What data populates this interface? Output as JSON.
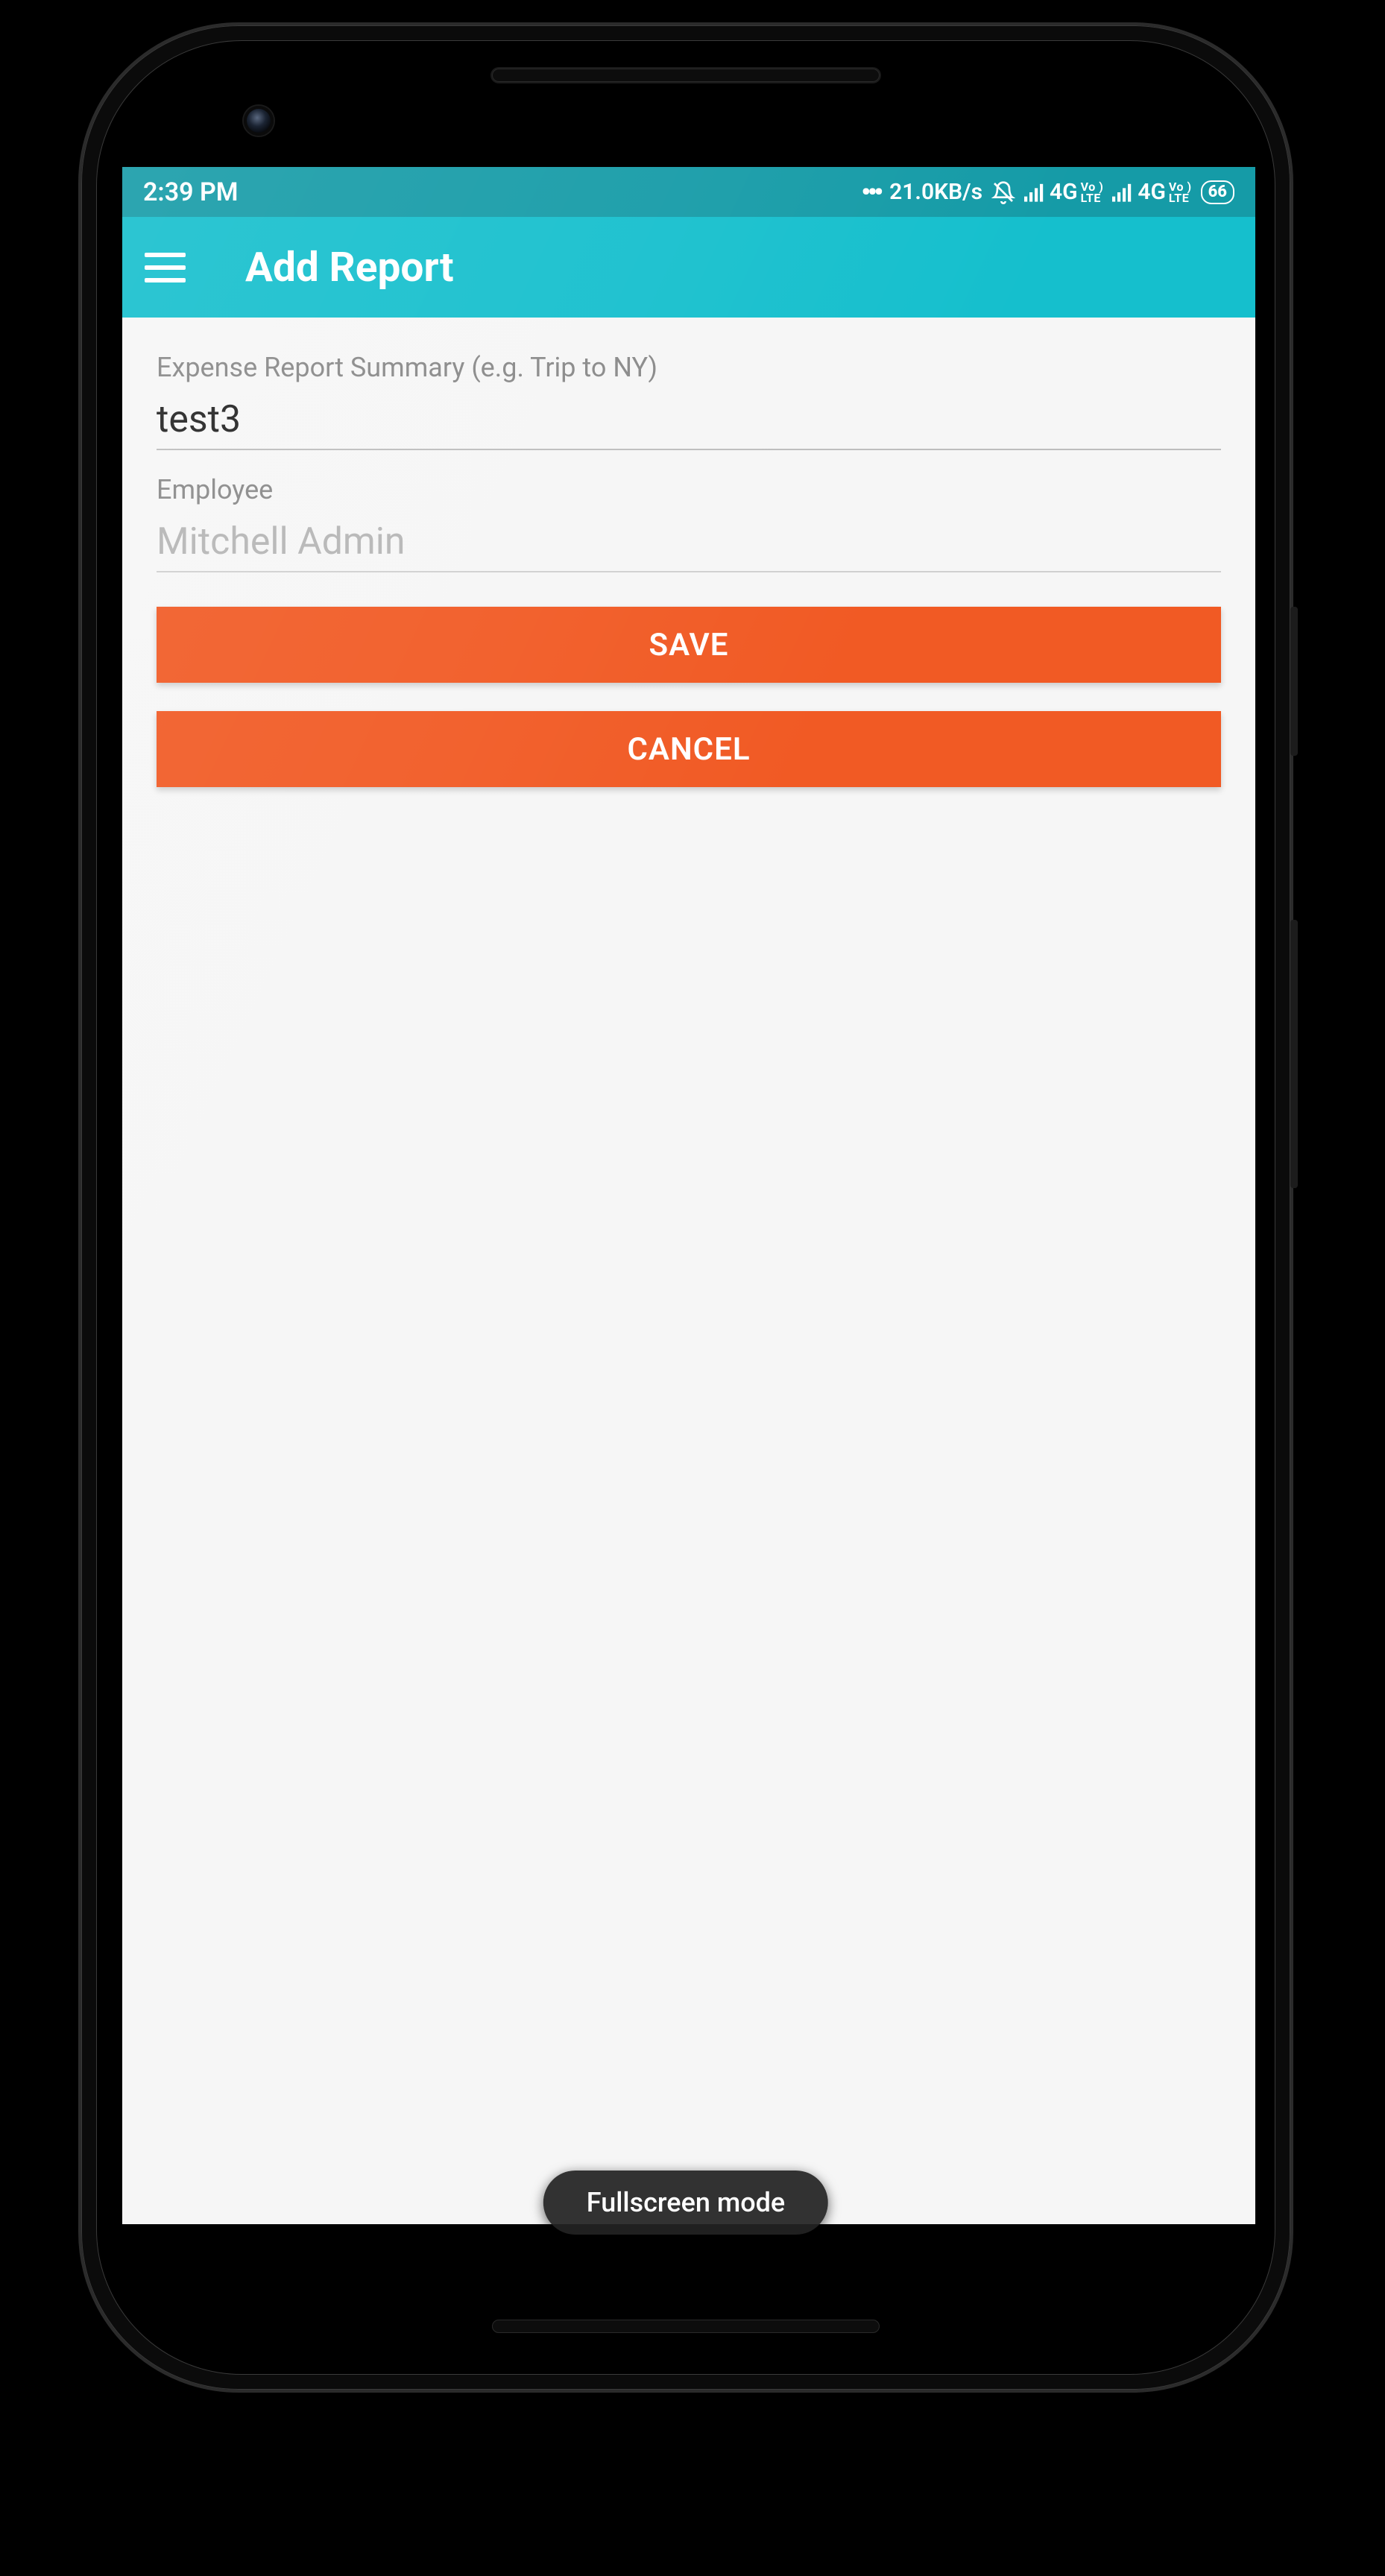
{
  "statusbar": {
    "time": "2:39 PM",
    "netspeed": "21.0KB/s",
    "network_label": "4G",
    "volte_top": "Vo )",
    "volte_bottom": "LTE",
    "battery": "66"
  },
  "appbar": {
    "title": "Add Report"
  },
  "form": {
    "summary_label": "Expense Report Summary (e.g. Trip to NY)",
    "summary_value": "test3",
    "employee_label": "Employee",
    "employee_value": "Mitchell Admin",
    "save_label": "SAVE",
    "cancel_label": "CANCEL"
  },
  "overlay": {
    "fullscreen": "Fullscreen mode"
  }
}
